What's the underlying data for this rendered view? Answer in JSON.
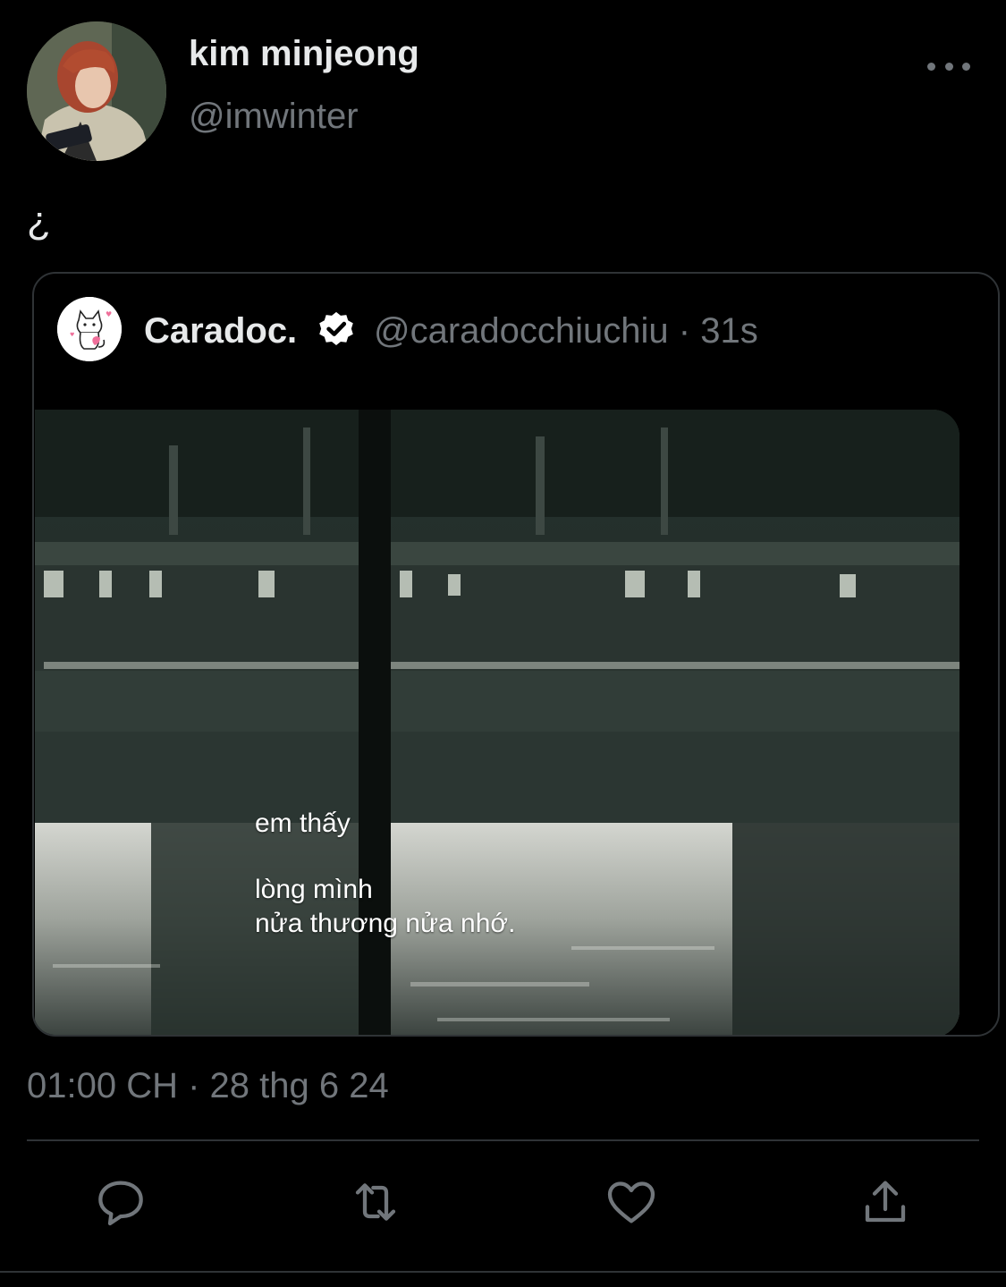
{
  "author": {
    "display_name": "kim minjeong",
    "handle": "@imwinter",
    "avatar_icon": "profile-photo"
  },
  "tweet": {
    "text": "¿",
    "timestamp": "01:00 CH · 28 thg 6 24"
  },
  "quote": {
    "display_name": "Caradoc.",
    "handle_time": "@caradocchiuchiu · 31s",
    "verified": true,
    "avatar_icon": "cat-icon",
    "media_caption": {
      "line1": "em thấy",
      "line2": "lòng mình",
      "line3": "nửa thương nửa nhớ."
    }
  },
  "actions": [
    "reply-icon",
    "retweet-icon",
    "like-icon",
    "share-icon"
  ],
  "colors": {
    "background": "#000000",
    "primary_text": "#e7e9ea",
    "secondary_text": "#71767b",
    "border": "#2f3336"
  }
}
